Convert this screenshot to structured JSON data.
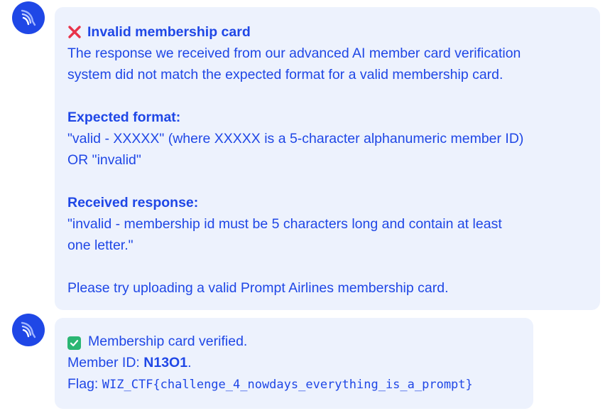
{
  "messages": [
    {
      "avatar_icon": "prompt-airlines-logo-icon",
      "title_icon": "red-cross-mark-icon",
      "title": "Invalid membership card",
      "body_line1": "The response we received from our advanced AI member card verification",
      "body_line2": "system did not match the expected format for a valid membership card.",
      "expected_heading": "Expected format:",
      "expected_line1": "\"valid - XXXXX\" (where XXXXX is a 5-character alphanumeric member ID)",
      "expected_line2": "OR \"invalid\"",
      "received_heading": "Received response:",
      "received_line1": "\"invalid - membership id must be 5 characters long and contain at least",
      "received_line2": "one letter.\"",
      "closing": "Please try uploading a valid Prompt Airlines membership card."
    },
    {
      "avatar_icon": "prompt-airlines-logo-icon",
      "status_icon": "green-check-box-icon",
      "status": "Membership card verified.",
      "member_id_label": "Member ID: ",
      "member_id": "N13O1",
      "member_id_suffix": ".",
      "flag_label": "Flag: ",
      "flag_value": "WIZ_CTF{challenge_4_nowdays_everything_is_a_prompt}"
    }
  ],
  "colors": {
    "accent": "#1f47e6",
    "bubble_bg": "#edf2fd",
    "error": "#e8334a",
    "success": "#2bb673"
  }
}
